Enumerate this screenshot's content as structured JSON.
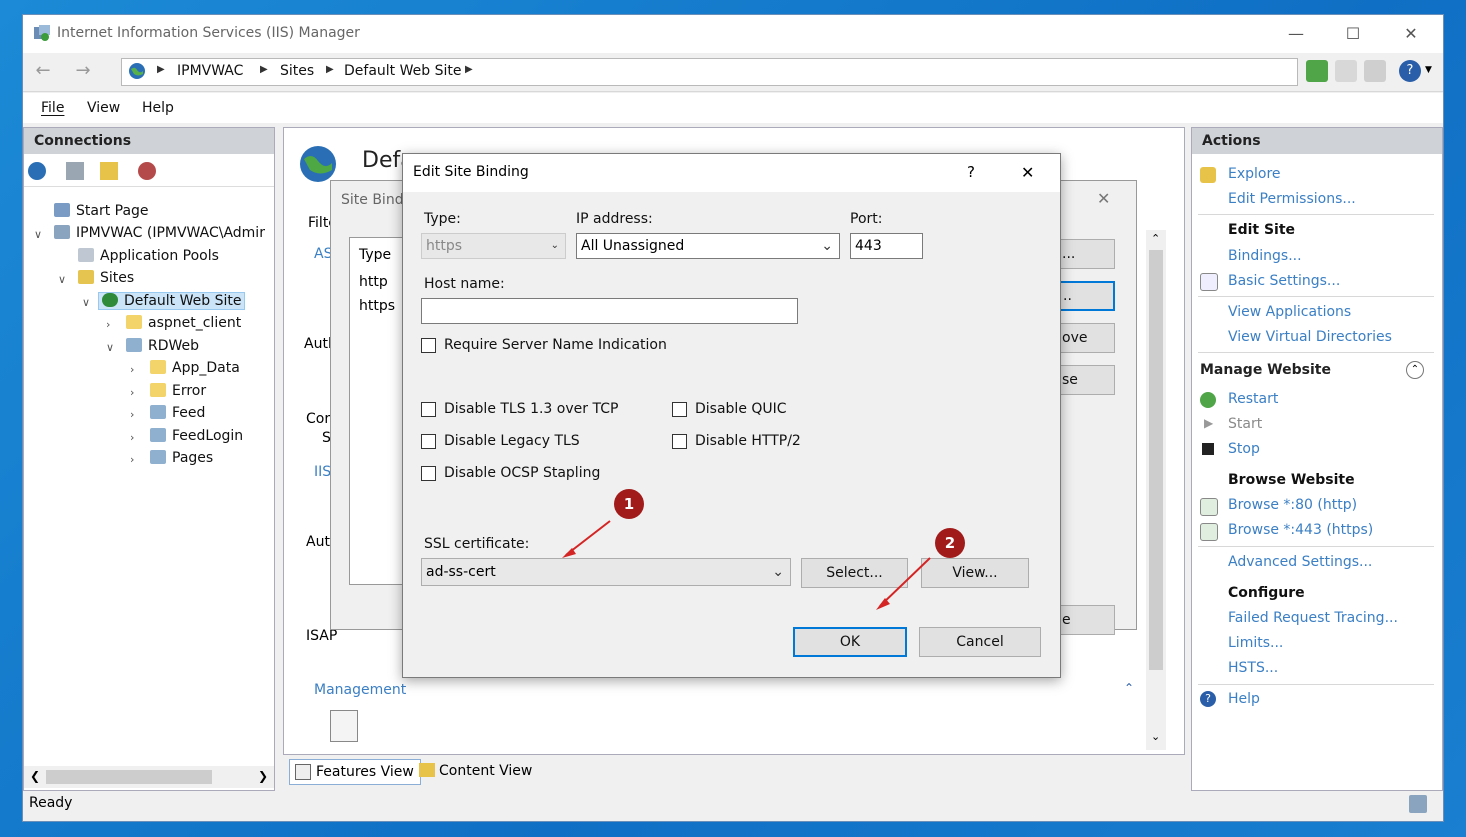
{
  "window": {
    "title": "Internet Information Services (IIS) Manager",
    "minimize": "—",
    "maximize": "☐",
    "close": "✕"
  },
  "address": {
    "crumbs": [
      "IPMVWAC",
      "Sites",
      "Default Web Site"
    ]
  },
  "menu": [
    "File",
    "View",
    "Help"
  ],
  "connections": {
    "title": "Connections",
    "tree": [
      {
        "label": "Start Page",
        "icon": "start-page-icon"
      },
      {
        "label": "IPMVWAC (IPMVWAC\\Admir",
        "icon": "server-icon"
      },
      {
        "label": "Application Pools",
        "icon": "app-pools-icon"
      },
      {
        "label": "Sites",
        "icon": "sites-folder-icon"
      },
      {
        "label": "Default Web Site",
        "icon": "globe-icon"
      },
      {
        "label": "aspnet_client",
        "icon": "folder-icon"
      },
      {
        "label": "RDWeb",
        "icon": "web-app-icon"
      },
      {
        "label": "App_Data",
        "icon": "folder-icon"
      },
      {
        "label": "Error",
        "icon": "folder-icon"
      },
      {
        "label": "Feed",
        "icon": "web-app-icon"
      },
      {
        "label": "FeedLogin",
        "icon": "web-app-icon"
      },
      {
        "label": "Pages",
        "icon": "web-app-icon"
      }
    ]
  },
  "center": {
    "title_partial": "Defa",
    "filter_partial": "Filte",
    "group_partial": [
      "AS",
      "Auth",
      "Cor",
      "S",
      "IIS",
      "Aut",
      "ISAP"
    ],
    "management_label": "Management",
    "bindings_bg": {
      "title_partial": "Site Bindi",
      "column_type": "Type",
      "rows": [
        "http",
        "https"
      ],
      "btn_partials": [
        "...",
        "..",
        "ove",
        "se",
        "e"
      ]
    }
  },
  "bottom_tabs": {
    "features_view": "Features View",
    "content_view": "Content View"
  },
  "actions": {
    "title": "Actions",
    "explore": "Explore",
    "edit_permissions": "Edit Permissions...",
    "edit_site_header": "Edit Site",
    "bindings": "Bindings...",
    "basic_settings": "Basic Settings...",
    "view_applications": "View Applications",
    "view_virtual_directories": "View Virtual Directories",
    "manage_website_header": "Manage Website",
    "restart": "Restart",
    "start": "Start",
    "stop": "Stop",
    "browse_website_header": "Browse Website",
    "browse_80": "Browse *:80 (http)",
    "browse_443": "Browse *:443 (https)",
    "advanced_settings": "Advanced Settings...",
    "configure_header": "Configure",
    "failed_request_tracing": "Failed Request Tracing...",
    "limits": "Limits...",
    "hsts": "HSTS...",
    "help": "Help"
  },
  "status": {
    "text": "Ready"
  },
  "dialog": {
    "title": "Edit Site Binding",
    "help_button": "?",
    "close_button": "✕",
    "type_label": "Type:",
    "type_value": "https",
    "ip_label": "IP address:",
    "ip_value": "All Unassigned",
    "port_label": "Port:",
    "port_value": "443",
    "host_label": "Host name:",
    "host_value": "",
    "require_sni": "Require Server Name Indication",
    "disable_tls13": "Disable TLS 1.3 over TCP",
    "disable_quic": "Disable QUIC",
    "disable_legacy_tls": "Disable Legacy TLS",
    "disable_http2": "Disable HTTP/2",
    "disable_ocsp": "Disable OCSP Stapling",
    "ssl_label": "SSL certificate:",
    "ssl_value": "ad-ss-cert",
    "select_button": "Select...",
    "view_button": "View...",
    "ok_button": "OK",
    "cancel_button": "Cancel"
  },
  "annotations": {
    "badge1": "1",
    "badge2": "2",
    "arrow_color": "#d42424",
    "badge_color": "#a21b1b"
  }
}
